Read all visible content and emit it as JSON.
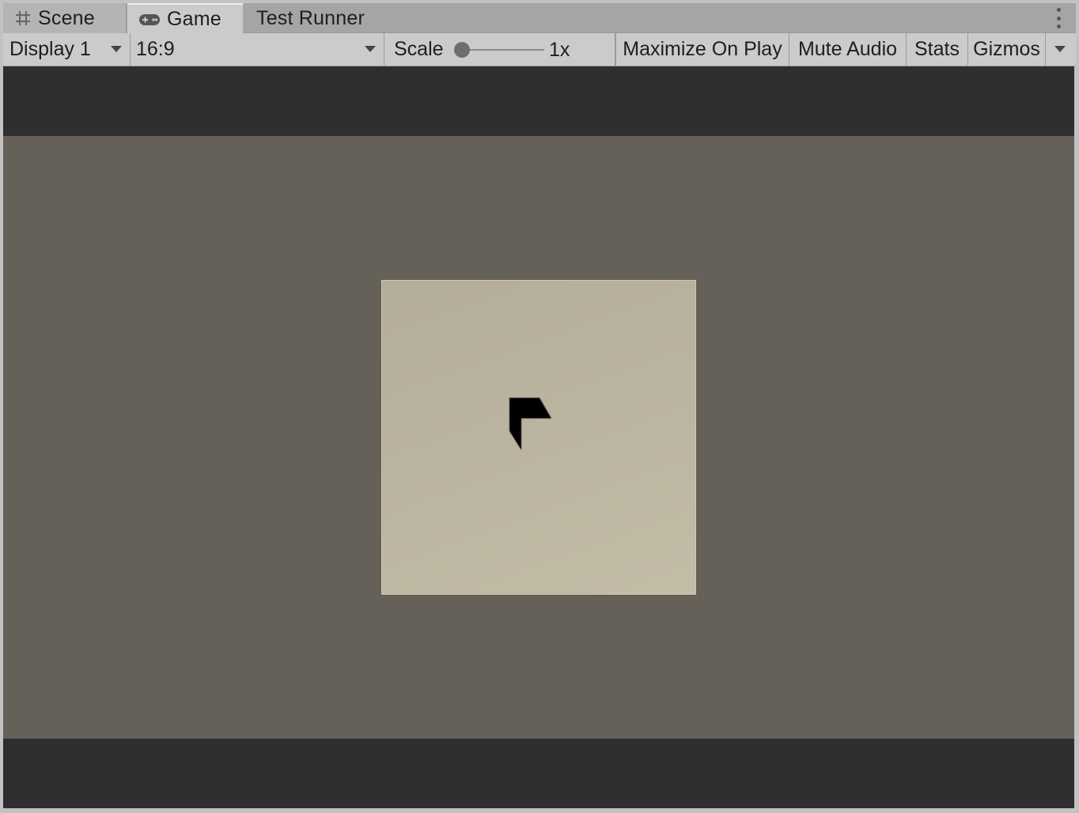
{
  "tabs": {
    "scene_label": "Scene",
    "game_label": "Game",
    "test_runner_label": "Test Runner"
  },
  "toolbar": {
    "display_label": "Display 1",
    "aspect_label": "16:9",
    "scale_label": "Scale",
    "scale_value": "1x",
    "maximize_label": "Maximize On Play",
    "mute_label": "Mute Audio",
    "stats_label": "Stats",
    "gizmos_label": "Gizmos"
  },
  "colors": {
    "letterbox": "#2f2f2f",
    "game_background": "#656058",
    "tile": "#bbb4a0",
    "marker": "#000000"
  },
  "icons": {
    "scene_tab": "grid-icon",
    "game_tab": "gamepad-icon",
    "menu": "kebab-menu-icon"
  }
}
